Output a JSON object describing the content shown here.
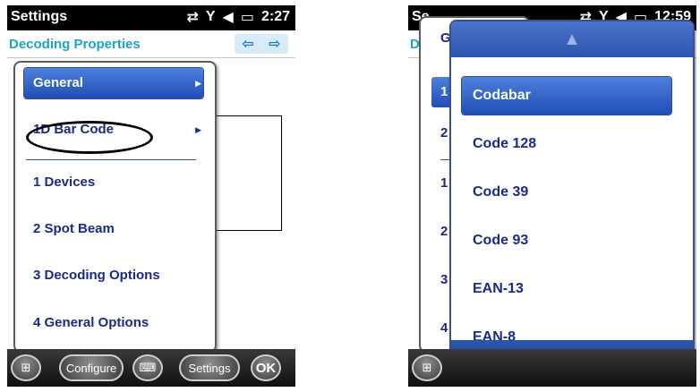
{
  "left": {
    "status": {
      "title": "Settings",
      "time": "2:27"
    },
    "header": {
      "title": "Decoding Properties",
      "back_arrow": "⇦",
      "forward_arrow": "⇨"
    },
    "menu": {
      "items": [
        {
          "label": "General",
          "selected": true,
          "has_submenu": true
        },
        {
          "label": "1D Bar Code",
          "selected": false,
          "has_submenu": true
        },
        {
          "label": "1 Devices"
        },
        {
          "label": "2 Spot Beam"
        },
        {
          "label": "3 Decoding Options"
        },
        {
          "label": "4 General Options"
        }
      ]
    },
    "taskbar": {
      "configure": "Configure",
      "settings": "Settings",
      "ok": "OK"
    }
  },
  "right": {
    "status": {
      "title": "Se",
      "time": "12:59"
    },
    "header": {
      "title": "D"
    },
    "behind_menu": {
      "items": [
        "G",
        "1",
        "2",
        "1",
        "2",
        "3",
        "4"
      ]
    },
    "picker": {
      "up_arrow": "▲",
      "down_arrow": "▼",
      "options": [
        "Codabar",
        "Code 128",
        "Code 39",
        "Code 93",
        "EAN-13",
        "EAN-8"
      ],
      "selected_index": 0
    }
  },
  "colors": {
    "accent": "#1f4fb5",
    "menu_text": "#1b2a86",
    "header_title": "#1aa5c2"
  },
  "icons": [
    "connection-icon",
    "signal-icon",
    "volume-icon",
    "battery-icon",
    "windows-start-icon",
    "keyboard-icon"
  ]
}
